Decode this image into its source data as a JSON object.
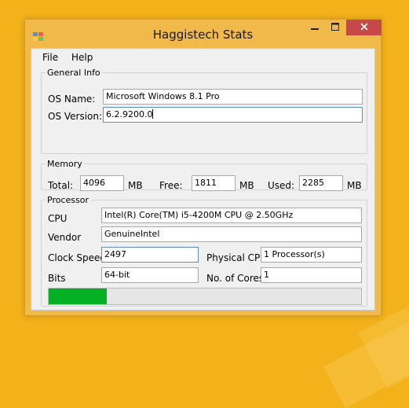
{
  "window": {
    "title": "Haggistech Stats"
  },
  "menu": {
    "file": "File",
    "help": "Help"
  },
  "general_info": {
    "title": "General Info",
    "os_name_label": "OS Name:",
    "os_name": "Microsoft Windows 8.1 Pro",
    "os_version_label": "OS Version:",
    "os_version": "6.2.9200.0"
  },
  "memory": {
    "title": "Memory",
    "total_label": "Total:",
    "total": "4096",
    "free_label": "Free:",
    "free": "1811",
    "used_label": "Used:",
    "used": "2285",
    "unit": "MB"
  },
  "processor": {
    "title": "Processor",
    "cpu_label": "CPU",
    "cpu": "Intel(R) Core(TM) i5-4200M CPU @ 2.50GHz",
    "vendor_label": "Vendor",
    "vendor": "GenuineIntel",
    "clock_speed_label": "Clock Speed",
    "clock_speed": "2497",
    "physical_cpu_label": "Physical CPU:",
    "physical_cpu": "1 Processor(s)",
    "bits_label": "Bits",
    "bits": "64-bit",
    "cores_label": "No. of Cores",
    "cores": "1",
    "load_fraction": 0.185
  },
  "colors": {
    "progress": "#06b025",
    "close": "#c74848",
    "desktop": "#f3b21a"
  },
  "icons": {
    "app": "app-window-icon",
    "minimize": "minimize-icon",
    "maximize": "maximize-icon",
    "close": "close-icon"
  }
}
